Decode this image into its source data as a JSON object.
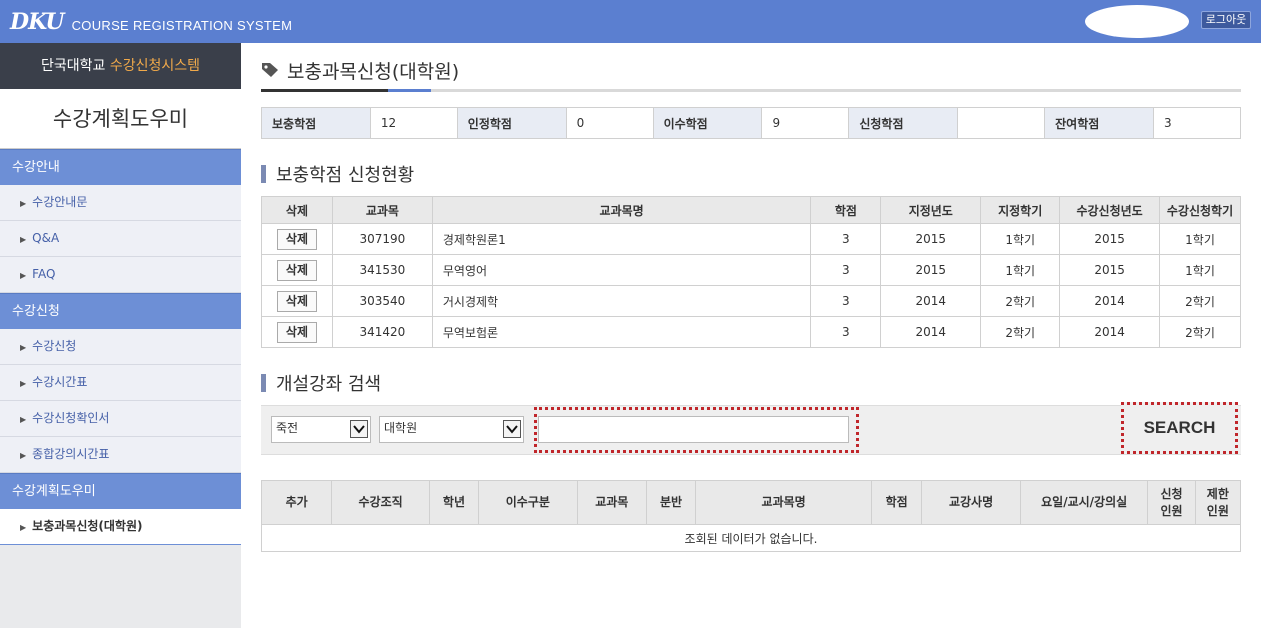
{
  "header": {
    "logo_mark": "DKU",
    "system_name": "COURSE REGISTRATION SYSTEM",
    "logout_label": "로그아웃"
  },
  "sidebar": {
    "school": "단국대학교",
    "system": "수강신청시스템",
    "title": "수강계획도우미",
    "sections": [
      {
        "label": "수강안내",
        "items": [
          "수강안내문",
          "Q&A",
          "FAQ"
        ]
      },
      {
        "label": "수강신청",
        "items": [
          "수강신청",
          "수강시간표",
          "수강신청확인서",
          "종합강의시간표"
        ]
      },
      {
        "label": "수강계획도우미",
        "items": [
          "보충과목신청(대학원)"
        ]
      }
    ]
  },
  "page": {
    "title": "보충과목신청(대학원)"
  },
  "credits": {
    "items": [
      {
        "label": "보충학점",
        "value": "12"
      },
      {
        "label": "인정학점",
        "value": "0"
      },
      {
        "label": "이수학점",
        "value": "9"
      },
      {
        "label": "신청학점",
        "value": ""
      },
      {
        "label": "잔여학점",
        "value": "3"
      }
    ]
  },
  "status_section": {
    "heading": "보충학점 신청현황",
    "columns": [
      "삭제",
      "교과목",
      "교과목명",
      "학점",
      "지정년도",
      "지정학기",
      "수강신청년도",
      "수강신청학기"
    ],
    "delete_label": "삭제",
    "rows": [
      {
        "code": "307190",
        "name": "경제학원론1",
        "credit": "3",
        "year": "2015",
        "term": "1학기",
        "reg_year": "2015",
        "reg_term": "1학기"
      },
      {
        "code": "341530",
        "name": "무역영어",
        "credit": "3",
        "year": "2015",
        "term": "1학기",
        "reg_year": "2015",
        "reg_term": "1학기"
      },
      {
        "code": "303540",
        "name": "거시경제학",
        "credit": "3",
        "year": "2014",
        "term": "2학기",
        "reg_year": "2014",
        "reg_term": "2학기"
      },
      {
        "code": "341420",
        "name": "무역보험론",
        "credit": "3",
        "year": "2014",
        "term": "2학기",
        "reg_year": "2014",
        "reg_term": "2학기"
      }
    ]
  },
  "search_section": {
    "heading": "개설강좌 검색",
    "campus_select": "죽전",
    "level_select": "대학원",
    "keyword_value": "",
    "search_label": "SEARCH"
  },
  "result_table": {
    "columns": [
      [
        "추가"
      ],
      [
        "수강조직"
      ],
      [
        "학년"
      ],
      [
        "이수구분"
      ],
      [
        "교과목"
      ],
      [
        "분반"
      ],
      [
        "교과목명"
      ],
      [
        "학점"
      ],
      [
        "교강사명"
      ],
      [
        "요일/교시/강의실"
      ],
      [
        "신청",
        "인원"
      ],
      [
        "제한",
        "인원"
      ]
    ],
    "empty_message": "조회된 데이터가 없습니다."
  },
  "colors": {
    "topbar": "#5b7fd0",
    "sidebar_section": "#6d8fd6",
    "sidebar_header": "#3a3f4a",
    "highlight": "#f0a94a",
    "dotted_border": "#c0262b"
  }
}
